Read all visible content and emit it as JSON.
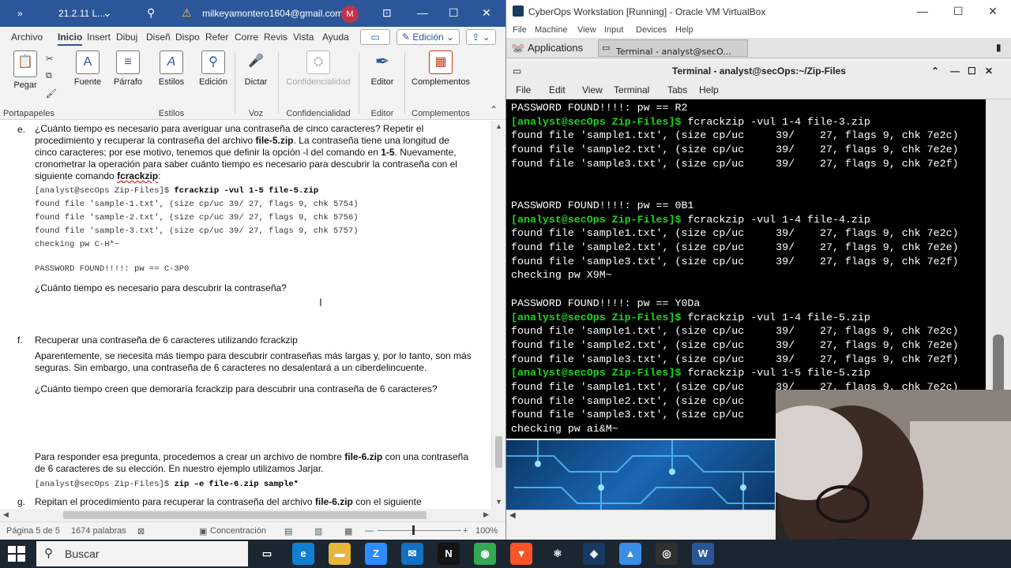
{
  "word": {
    "titlebar": {
      "chevrons": "»",
      "doc_name": "21.2.11 L...",
      "user_email": "milkeyamontero1604@gmail.com",
      "avatar_letter": "M"
    },
    "menu_tabs": [
      "Archivo",
      "Inicio",
      "Insert",
      "Dibuj",
      "Diseñ",
      "Dispo",
      "Refer",
      "Corre",
      "Revis",
      "Vista",
      "Ayuda"
    ],
    "edit_mode": "Edición",
    "ribbon": {
      "pegar": "Pegar",
      "fuente": "Fuente",
      "parrafo": "Párrafo",
      "estilos": "Estilos",
      "edicion": "Edición",
      "dictar": "Dictar",
      "confidencialidad": "Confidencialidad",
      "editor": "Editor",
      "complementos": "Complementos",
      "groups": {
        "portapapeles": "Portapapeles",
        "estilos": "Estilos",
        "voz": "Voz",
        "confidencialidad": "Confidencialidad",
        "editor": "Editor",
        "complementos": "Complementos"
      }
    },
    "doc": {
      "e_letter": "e.",
      "e_para_1": "¿Cuánto tiempo es necesario para averiguar una contraseña de cinco caracteres? Repetir el",
      "e_para_2a": "procedimiento y recuperar la contraseña del archivo ",
      "e_para_2b": "file-5.zip",
      "e_para_2c": ". La contraseña tiene una longitud de",
      "e_para_3a": "cinco caracteres; por ese motivo, tenemos que definir la opción -l del comando en ",
      "e_para_3b": "1-5",
      "e_para_3c": ". Nuevamente,",
      "e_para_4": "cronometrar la operación para saber cuánto tiempo es necesario para descubrir la contraseña con el",
      "e_para_5a": "siguiente comando ",
      "e_para_5b": "fcrackzip",
      "e_para_5c": ":",
      "code_1a": "[analyst@secOps Zip-Files]$ ",
      "code_1b": "fcrackzip -vul 1-5 file-5.zip",
      "code_2": "found file 'sample-1.txt', (size cp/uc 39/ 27, flags 9, chk 5754)",
      "code_3": "found file 'sample-2.txt', (size cp/uc 39/ 27, flags 9, chk 5756)",
      "code_4": "found file 'sample-3.txt', (size cp/uc 39/ 27, flags 9, chk 5757)",
      "code_5": "checking pw C-H*~",
      "code_6": "PASSWORD FOUND!!!!: pw == C-3P0",
      "question_e": "¿Cuánto tiempo es necesario para descubrir la contraseña?",
      "f_letter": "f.",
      "f_title": "Recuperar una contraseña de 6 caracteres utilizando fcrackzip",
      "f_para_1": "Aparentemente, se necesita más tiempo para descubrir contraseñas más largas y, por lo tanto, son más",
      "f_para_2": "seguras. Sin embargo, una contraseña de 6 caracteres no desalentará a un ciberdelincuente.",
      "question_f": "¿Cuánto tiempo creen que demoraría fcrackzip para descubrir una contraseña de 6 caracteres?",
      "f_para_3a": "Para responder esa pregunta, procedemos a crear un archivo de nombre ",
      "f_para_3b": "file-6.zip",
      "f_para_3c": " con una contraseña",
      "f_para_4": "de 6 caracteres de su elección. En nuestro ejemplo utilizamos Jarjar.",
      "code_7a": "[analyst@secOps Zip-Files]$ ",
      "code_7b": "zip –e file-6.zip sample*",
      "g_letter": "g.",
      "g_para_1a": "Repitan el procedimiento para recuperar la contraseña del archivo ",
      "g_para_1b": "file-6.zip",
      "g_para_1c": " con el siguiente"
    },
    "status": {
      "page": "Página 5 de 5",
      "words": "1674 palabras",
      "focus": "Concentración",
      "zoom": "100%"
    }
  },
  "vbox": {
    "title": "CyberOps Workstation [Running] - Oracle VM VirtualBox",
    "menu": [
      "File",
      "Machine",
      "View",
      "Input",
      "Devices",
      "Help"
    ],
    "panel": {
      "applications": "Applications",
      "task": "Terminal - analyst@secO..."
    },
    "terminal": {
      "title": "Terminal - analyst@secOps:~/Zip-Files",
      "menu": [
        "File",
        "Edit",
        "View",
        "Terminal",
        "Tabs",
        "Help"
      ],
      "lines": [
        {
          "prompt": "",
          "text": "PASSWORD FOUND!!!!: pw == R2"
        },
        {
          "prompt": "[analyst@secOps Zip-Files]$ ",
          "text": "fcrackzip -vul 1-4 file-3.zip"
        },
        {
          "prompt": "",
          "text": "found file 'sample1.txt', (size cp/uc     39/    27, flags 9, chk 7e2c)"
        },
        {
          "prompt": "",
          "text": "found file 'sample2.txt', (size cp/uc     39/    27, flags 9, chk 7e2e)"
        },
        {
          "prompt": "",
          "text": "found file 'sample3.txt', (size cp/uc     39/    27, flags 9, chk 7e2f)"
        },
        {
          "prompt": "",
          "text": ""
        },
        {
          "prompt": "",
          "text": ""
        },
        {
          "prompt": "",
          "text": "PASSWORD FOUND!!!!: pw == 0B1"
        },
        {
          "prompt": "[analyst@secOps Zip-Files]$ ",
          "text": "fcrackzip -vul 1-4 file-4.zip"
        },
        {
          "prompt": "",
          "text": "found file 'sample1.txt', (size cp/uc     39/    27, flags 9, chk 7e2c)"
        },
        {
          "prompt": "",
          "text": "found file 'sample2.txt', (size cp/uc     39/    27, flags 9, chk 7e2e)"
        },
        {
          "prompt": "",
          "text": "found file 'sample3.txt', (size cp/uc     39/    27, flags 9, chk 7e2f)"
        },
        {
          "prompt": "",
          "text": "checking pw X9M~"
        },
        {
          "prompt": "",
          "text": ""
        },
        {
          "prompt": "",
          "text": "PASSWORD FOUND!!!!: pw == Y0Da"
        },
        {
          "prompt": "[analyst@secOps Zip-Files]$ ",
          "text": "fcrackzip -vul 1-4 file-5.zip"
        },
        {
          "prompt": "",
          "text": "found file 'sample1.txt', (size cp/uc     39/    27, flags 9, chk 7e2c)"
        },
        {
          "prompt": "",
          "text": "found file 'sample2.txt', (size cp/uc     39/    27, flags 9, chk 7e2e)"
        },
        {
          "prompt": "",
          "text": "found file 'sample3.txt', (size cp/uc     39/    27, flags 9, chk 7e2f)"
        },
        {
          "prompt": "[analyst@secOps Zip-Files]$ ",
          "text": "fcrackzip -vul 1-5 file-5.zip"
        },
        {
          "prompt": "",
          "text": "found file 'sample1.txt', (size cp/uc     39/    27, flags 9, chk 7e2c)"
        },
        {
          "prompt": "",
          "text": "found file 'sample2.txt', (size cp/uc     39/"
        },
        {
          "prompt": "",
          "text": "found file 'sample3.txt', (size cp/uc     39/"
        },
        {
          "prompt": "",
          "text": "checking pw ai&M~"
        }
      ]
    }
  },
  "taskbar": {
    "search_placeholder": "Buscar",
    "apps": [
      {
        "icon": "task-view-icon",
        "glyph": "▭",
        "color": "#1c2631"
      },
      {
        "icon": "edge-icon",
        "glyph": "e",
        "color": "#0f7fd1"
      },
      {
        "icon": "file-explorer-icon",
        "glyph": "▬",
        "color": "#e8b53a"
      },
      {
        "icon": "zoom-icon",
        "glyph": "Z",
        "color": "#2d8cff"
      },
      {
        "icon": "mail-icon",
        "glyph": "✉",
        "color": "#1171c3"
      },
      {
        "icon": "netflix-icon",
        "glyph": "N",
        "color": "#141414"
      },
      {
        "icon": "chrome-icon",
        "glyph": "◉",
        "color": "#34a853"
      },
      {
        "icon": "brave-icon",
        "glyph": "▼",
        "color": "#fb542b"
      },
      {
        "icon": "atom-icon",
        "glyph": "⚛",
        "color": "#1c2631"
      },
      {
        "icon": "virtualbox-icon",
        "glyph": "◈",
        "color": "#183a61"
      },
      {
        "icon": "paint-icon",
        "glyph": "▲",
        "color": "#3a8ee6"
      },
      {
        "icon": "obs-icon",
        "glyph": "◎",
        "color": "#303030"
      },
      {
        "icon": "word-icon",
        "glyph": "W",
        "color": "#2b579a"
      }
    ]
  }
}
